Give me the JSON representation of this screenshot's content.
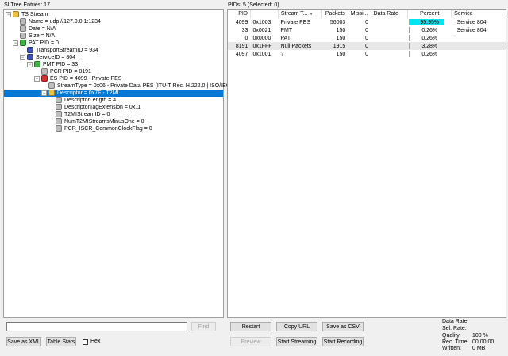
{
  "left_header": "SI Tree Entries: 17",
  "right_header": "PIDs: 5   (Selected: 0)",
  "tree": [
    {
      "label": "TS Stream",
      "indent": 0,
      "icon": "folder",
      "exp": "-"
    },
    {
      "label": "Name = udp://127.0.0.1:1234",
      "indent": 1,
      "icon": "gray",
      "exp": ""
    },
    {
      "label": "Date = N/A",
      "indent": 1,
      "icon": "gray",
      "exp": ""
    },
    {
      "label": "Size = N/A",
      "indent": 1,
      "icon": "gray",
      "exp": ""
    },
    {
      "label": "PAT PID = 0",
      "indent": 1,
      "icon": "green",
      "exp": "-"
    },
    {
      "label": "TransportStreamID = 934",
      "indent": 2,
      "icon": "blue",
      "exp": ""
    },
    {
      "label": "ServiceID = 804",
      "indent": 2,
      "icon": "blue",
      "exp": "-"
    },
    {
      "label": "PMT PID = 33",
      "indent": 3,
      "icon": "green",
      "exp": "-"
    },
    {
      "label": "PCR PID = 8191",
      "indent": 4,
      "icon": "gray",
      "exp": ""
    },
    {
      "label": "ES PID = 4099 - Private PES",
      "indent": 4,
      "icon": "red",
      "exp": "-"
    },
    {
      "label": "StreamType = 0x06 - Private Data PES (ITU-T Rec. H.222.0 | ISO/IEC 13818-1)",
      "indent": 5,
      "icon": "gray",
      "exp": ""
    },
    {
      "label": "Descriptor = 0x7F - T2MI",
      "indent": 5,
      "icon": "folder",
      "exp": "-",
      "selected": true
    },
    {
      "label": "DescriptorLength = 4",
      "indent": 6,
      "icon": "gray",
      "exp": ""
    },
    {
      "label": "DescriptorTagExtension = 0x11",
      "indent": 6,
      "icon": "gray",
      "exp": ""
    },
    {
      "label": "T2MIStreamID = 0",
      "indent": 6,
      "icon": "gray",
      "exp": ""
    },
    {
      "label": "NumT2MIStreamsMinusOne = 0",
      "indent": 6,
      "icon": "gray",
      "exp": ""
    },
    {
      "label": "PCR_ISCR_CommonClockFlag = 0",
      "indent": 6,
      "icon": "gray",
      "exp": ""
    }
  ],
  "pid_columns": [
    "PID",
    "",
    "Stream T...",
    "Packets",
    "Missi...",
    "Data Rate",
    "Percent",
    "Service"
  ],
  "pid_rows": [
    {
      "pid": "4099",
      "hex": "0x1003",
      "type": "Private PES",
      "packets": "56003",
      "missing": "0",
      "rate": "",
      "percent": "95.95%",
      "pct_value": 95.95,
      "service": "_Service 804"
    },
    {
      "pid": "33",
      "hex": "0x0021",
      "type": "PMT",
      "packets": "150",
      "missing": "0",
      "rate": "",
      "percent": "0.26%",
      "pct_value": 0.26,
      "service": "_Service 804"
    },
    {
      "pid": "0",
      "hex": "0x0000",
      "type": "PAT",
      "packets": "150",
      "missing": "0",
      "rate": "",
      "percent": "0.26%",
      "pct_value": 0.26,
      "service": ""
    },
    {
      "pid": "8191",
      "hex": "0x1FFF",
      "type": "Null Packets",
      "packets": "1915",
      "missing": "0",
      "rate": "",
      "percent": "3.28%",
      "pct_value": 3.28,
      "service": ""
    },
    {
      "pid": "4097",
      "hex": "0x1001",
      "type": "?",
      "packets": "150",
      "missing": "0",
      "rate": "",
      "percent": "0.26%",
      "pct_value": 0.26,
      "service": ""
    }
  ],
  "search": {
    "value": "",
    "find_label": "Find"
  },
  "left_buttons": {
    "save_xml": "Save as XML",
    "table_stats": "Table Stats",
    "hex_label": "Hex"
  },
  "right_buttons": {
    "restart": "Restart",
    "copy_url": "Copy URL",
    "save_csv": "Save as CSV",
    "preview": "Preview",
    "start_streaming": "Start Streaming",
    "start_recording": "Start Recording"
  },
  "stats": {
    "data_rate_label": "Data Rate:",
    "data_rate_value": "",
    "sel_rate_label": "Sel. Rate:",
    "sel_rate_value": "",
    "quality_label": "Quality:",
    "quality_value": "100 %",
    "rec_time_label": "Rec. Time:",
    "rec_time_value": "00:00:00",
    "written_label": "Written:",
    "written_value": "0 MB"
  },
  "colors": {
    "selection": "#0078d7",
    "percent_bar": "#00e5f0"
  }
}
